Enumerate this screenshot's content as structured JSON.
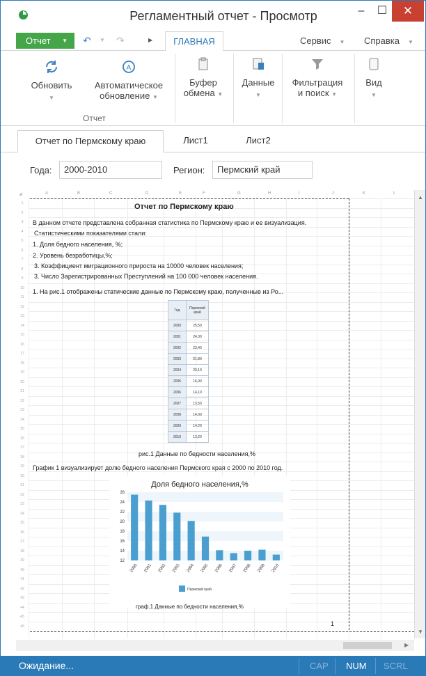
{
  "window": {
    "title": "Регламентный отчет - Просмотр",
    "min_label": "–",
    "max_label": "☐",
    "close_label": "✕"
  },
  "menu": {
    "report_label": "Отчет",
    "tabs": [
      "ГЛАВНАЯ",
      "Сервис",
      "Справка"
    ]
  },
  "ribbon": {
    "refresh": "Обновить",
    "auto_refresh_1": "Автоматическое",
    "auto_refresh_2": "обновление",
    "group_report": "Отчет",
    "clipboard_1": "Буфер",
    "clipboard_2": "обмена",
    "data": "Данные",
    "filter_1": "Фильтрация",
    "filter_2": "и поиск",
    "view": "Вид"
  },
  "sheet_tabs": [
    "Отчет по Пермскому краю",
    "Лист1",
    "Лист2"
  ],
  "params": {
    "years_label": "Года:",
    "years_value": "2000-2010",
    "region_label": "Регион:",
    "region_value": "Пермский край"
  },
  "columns": [
    "A",
    "B",
    "C",
    "D",
    "E",
    "F",
    "G",
    "H",
    "I",
    "J",
    "K",
    "L"
  ],
  "report": {
    "title": "Отчет по Пермскому краю",
    "line1": "В данном отчете представлена собранная статистика по Пермскому краю и ее визуализация.",
    "line2": "Статистическими показателями стали:",
    "item1": "1. Доля бедного населения, %;",
    "item2": "2. Уровень безработицы,%;",
    "item3": "3. Коэффициент миграционного прироста на 10000 человек населения;",
    "item4": "3. Число Зарегистрированных Преступлений на 100 000 человек населения.",
    "line3": "1. На рис.1 отображены статические данные по Пермскому краю, полученные из Ро...",
    "table_caption": "рис.1 Данные по бедности населения,%",
    "line4": "График 1 визуализирует долю бедного населения Пермского края с 2000 по 2010 год.",
    "chart_caption": "граф.1 Данные по бедности населения,%",
    "page_number": "1"
  },
  "table": {
    "header_year": "Год",
    "header_region": "Пермский край",
    "rows": [
      [
        "2000",
        "25,50"
      ],
      [
        "2001",
        "24,30"
      ],
      [
        "2002",
        "23,40"
      ],
      [
        "2003",
        "21,80"
      ],
      [
        "2004",
        "20,10"
      ],
      [
        "2005",
        "16,90"
      ],
      [
        "2006",
        "14,10"
      ],
      [
        "2007",
        "13,50"
      ],
      [
        "2008",
        "14,00"
      ],
      [
        "2009",
        "14,20"
      ],
      [
        "2010",
        "13,20"
      ]
    ]
  },
  "chart_data": {
    "type": "bar",
    "title": "Доля бедного населения,%",
    "categories": [
      "2000",
      "2001",
      "2002",
      "2003",
      "2004",
      "2005",
      "2006",
      "2007",
      "2008",
      "2009",
      "2010"
    ],
    "series": [
      {
        "name": "Пермский край",
        "values": [
          25.5,
          24.3,
          23.4,
          21.8,
          20.1,
          16.9,
          14.1,
          13.5,
          14.0,
          14.2,
          13.2
        ]
      }
    ],
    "yticks": [
      "26",
      "24",
      "22",
      "20",
      "18",
      "16",
      "14",
      "12"
    ],
    "ylim": [
      12,
      26
    ],
    "legend": "bottom",
    "color": "#4a9fd0"
  },
  "status": {
    "message": "Ожидание...",
    "cap": "CAP",
    "num": "NUM",
    "scrl": "SCRL"
  }
}
